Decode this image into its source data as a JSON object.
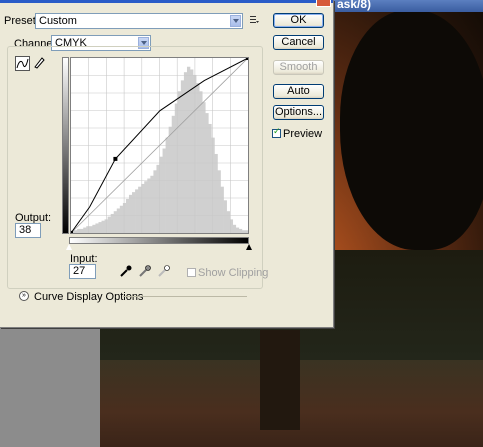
{
  "document": {
    "title_fragment": "ask/8)"
  },
  "dialog": {
    "preset": {
      "label": "Preset:",
      "value": "Custom"
    },
    "channel": {
      "label": "Channel:",
      "value": "CMYK"
    },
    "buttons": {
      "ok": "OK",
      "cancel": "Cancel",
      "smooth": "Smooth",
      "auto": "Auto",
      "options": "Options..."
    },
    "preview": {
      "label": "Preview",
      "checked": true
    },
    "output": {
      "label": "Output:",
      "value": "38"
    },
    "input": {
      "label": "Input:",
      "value": "27"
    },
    "show_clipping": {
      "label": "Show Clipping",
      "checked": false
    },
    "curve_display_options": "Curve Display Options"
  },
  "icons": {
    "menu": "preset-menu-icon",
    "curve_tool": "curve-point-tool-icon",
    "pencil_tool": "pencil-tool-icon",
    "black_eyedropper": "black-point-eyedropper-icon",
    "gray_eyedropper": "gray-point-eyedropper-icon",
    "white_eyedropper": "white-point-eyedropper-icon",
    "expand": "expand-icon"
  },
  "chart_data": {
    "type": "line",
    "xlim": [
      0,
      255
    ],
    "ylim": [
      0,
      255
    ],
    "grid": true,
    "series": [
      {
        "x": [
          0,
          255
        ],
        "y": [
          0,
          255
        ]
      },
      {
        "x": [
          0,
          27,
          64,
          128,
          192,
          255
        ],
        "y": [
          0,
          38,
          108,
          178,
          222,
          255
        ]
      }
    ],
    "control_points": [
      {
        "x": 0,
        "y": 0
      },
      {
        "x": 64,
        "y": 108
      },
      {
        "x": 255,
        "y": 255
      }
    ],
    "histogram": [
      2,
      2,
      3,
      3,
      4,
      5,
      5,
      6,
      7,
      8,
      9,
      10,
      12,
      14,
      16,
      18,
      20,
      22,
      25,
      28,
      30,
      32,
      34,
      36,
      38,
      40,
      42,
      46,
      50,
      56,
      62,
      70,
      78,
      86,
      95,
      104,
      112,
      118,
      122,
      120,
      116,
      110,
      104,
      96,
      88,
      80,
      70,
      58,
      46,
      34,
      24,
      16,
      10,
      6,
      4,
      3,
      2,
      2
    ]
  }
}
